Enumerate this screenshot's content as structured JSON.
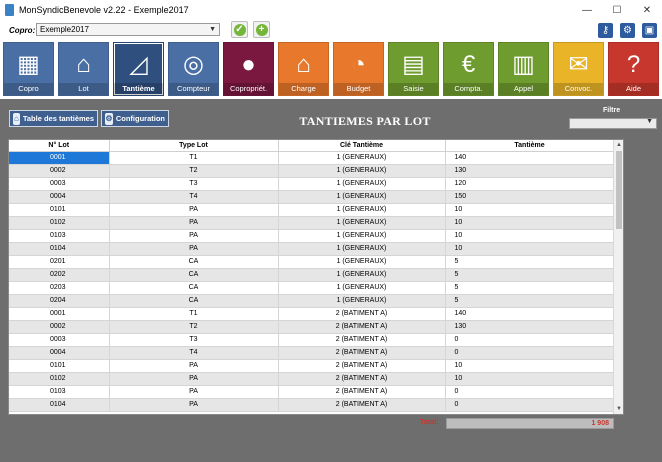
{
  "window": {
    "title": "MonSyndicBenevole v2.22 - Exemple2017",
    "minimize": "—",
    "maximize": "☐",
    "close": "✕"
  },
  "toolbar": {
    "copro_label": "Copro",
    "copro_value": "Exemple2017",
    "validate_icon": "check-icon",
    "add_icon": "plus-icon",
    "right_icons": [
      "key-icon",
      "gear-icon",
      "save-icon"
    ]
  },
  "tiles": [
    {
      "label": "Copro",
      "color": "#4a6fa5",
      "icon": "buildings-icon"
    },
    {
      "label": "Lot",
      "color": "#4a6fa5",
      "icon": "houses-icon"
    },
    {
      "label": "Tantième",
      "color": "#2f4f7f",
      "icon": "ruler-icon",
      "active": true
    },
    {
      "label": "Compteur",
      "color": "#4a6fa5",
      "icon": "meter-icon"
    },
    {
      "label": "Copropriét.",
      "color": "#7a1840",
      "icon": "person-icon"
    },
    {
      "label": "Charge",
      "color": "#e8782c",
      "icon": "house-doc-icon"
    },
    {
      "label": "Budget",
      "color": "#e8782c",
      "icon": "pie-icon"
    },
    {
      "label": "Saisie",
      "color": "#6f9c2e",
      "icon": "certificate-icon"
    },
    {
      "label": "Compta.",
      "color": "#6f9c2e",
      "icon": "ledger-icon"
    },
    {
      "label": "Appel",
      "color": "#6f9c2e",
      "icon": "invoice-icon"
    },
    {
      "label": "Convoc.",
      "color": "#e9b427",
      "icon": "envelope-icon"
    },
    {
      "label": "Aide",
      "color": "#c8372d",
      "icon": "question-icon"
    }
  ],
  "subheader": {
    "table_button": "Table des tantièmes",
    "config_button": "Configuration",
    "title": "TANTIEMES PAR LOT",
    "filter_label": "Filtre",
    "filter_value": ""
  },
  "table": {
    "columns": [
      "N° Lot",
      "Type Lot",
      "Clé Tantième",
      "Tantième"
    ],
    "rows": [
      [
        "0001",
        "T1",
        "1 (GENERAUX)",
        "140"
      ],
      [
        "0002",
        "T2",
        "1 (GENERAUX)",
        "130"
      ],
      [
        "0003",
        "T3",
        "1 (GENERAUX)",
        "120"
      ],
      [
        "0004",
        "T4",
        "1 (GENERAUX)",
        "150"
      ],
      [
        "0101",
        "PA",
        "1 (GENERAUX)",
        "10"
      ],
      [
        "0102",
        "PA",
        "1 (GENERAUX)",
        "10"
      ],
      [
        "0103",
        "PA",
        "1 (GENERAUX)",
        "10"
      ],
      [
        "0104",
        "PA",
        "1 (GENERAUX)",
        "10"
      ],
      [
        "0201",
        "CA",
        "1 (GENERAUX)",
        "5"
      ],
      [
        "0202",
        "CA",
        "1 (GENERAUX)",
        "5"
      ],
      [
        "0203",
        "CA",
        "1 (GENERAUX)",
        "5"
      ],
      [
        "0204",
        "CA",
        "1 (GENERAUX)",
        "5"
      ],
      [
        "0001",
        "T1",
        "2 (BATIMENT A)",
        "140"
      ],
      [
        "0002",
        "T2",
        "2 (BATIMENT A)",
        "130"
      ],
      [
        "0003",
        "T3",
        "2 (BATIMENT A)",
        "0"
      ],
      [
        "0004",
        "T4",
        "2 (BATIMENT A)",
        "0"
      ],
      [
        "0101",
        "PA",
        "2 (BATIMENT A)",
        "10"
      ],
      [
        "0102",
        "PA",
        "2 (BATIMENT A)",
        "10"
      ],
      [
        "0103",
        "PA",
        "2 (BATIMENT A)",
        "0"
      ],
      [
        "0104",
        "PA",
        "2 (BATIMENT A)",
        "0"
      ]
    ]
  },
  "total": {
    "label": "Total:",
    "value": "1 908"
  }
}
